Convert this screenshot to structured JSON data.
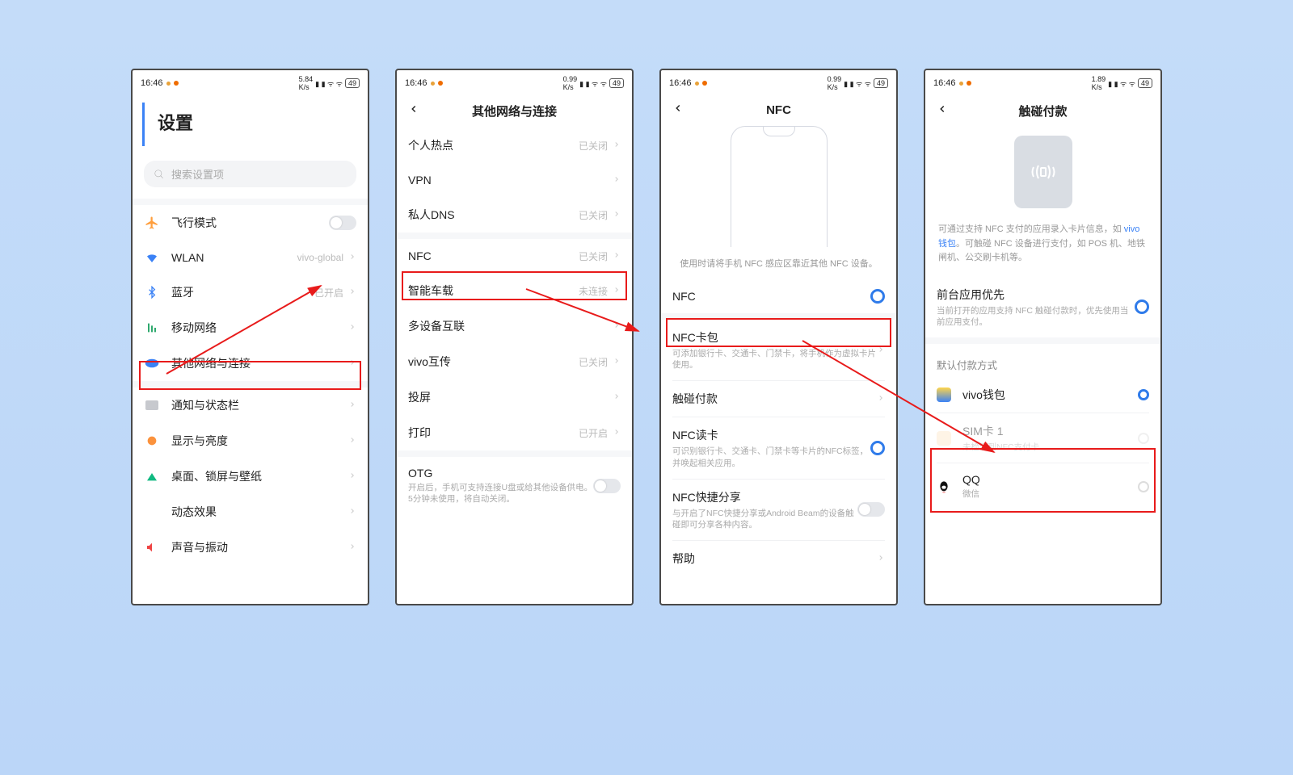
{
  "status": {
    "time": "16:46",
    "right_text": "49"
  },
  "p1": {
    "title": "设置",
    "search_placeholder": "搜索设置项",
    "rows": {
      "airplane": "飞行模式",
      "wlan": "WLAN",
      "wlan_val": "vivo-global",
      "bt": "蓝牙",
      "bt_val": "已开启",
      "mobile": "移动网络",
      "other": "其他网络与连接",
      "notif": "通知与状态栏",
      "display": "显示与亮度",
      "home": "桌面、锁屏与壁纸",
      "motion": "动态效果",
      "sound": "声音与振动"
    }
  },
  "p2": {
    "title": "其他网络与连接",
    "rows": {
      "hotspot": "个人热点",
      "hotspot_val": "已关闭",
      "vpn": "VPN",
      "dns": "私人DNS",
      "dns_val": "已关闭",
      "nfc": "NFC",
      "nfc_val": "已关闭",
      "car": "智能车载",
      "car_val": "未连接",
      "multi": "多设备互联",
      "vshare": "vivo互传",
      "vshare_val": "已关闭",
      "cast": "投屏",
      "print": "打印",
      "print_val": "已开启",
      "otg": "OTG",
      "otg_desc": "开启后，手机可支持连接U盘或给其他设备供电。5分钟未使用，将自动关闭。"
    }
  },
  "p3": {
    "title": "NFC",
    "hint": "使用时请将手机 NFC 感应区靠近其他 NFC 设备。",
    "rows": {
      "nfc": "NFC",
      "cardpkg": "NFC卡包",
      "cardpkg_desc": "可添加银行卡、交通卡、门禁卡，将手机作为虚拟卡片使用。",
      "tap": "触碰付款",
      "reader": "NFC读卡",
      "reader_desc": "可识别银行卡、交通卡、门禁卡等卡片的NFC标签，并唤起相关应用。",
      "share": "NFC快捷分享",
      "share_desc": "与开启了NFC快捷分享或Android Beam的设备触碰即可分享各种内容。",
      "help": "帮助"
    }
  },
  "p4": {
    "title": "触碰付款",
    "hint_html_before": "可通过支持 NFC 支付的应用录入卡片信息，如 ",
    "hint_link": "vivo钱包",
    "hint_html_after": "。可触碰 NFC 设备进行支付，如 POS 机、地铁闸机、公交刷卡机等。",
    "fg": "前台应用优先",
    "fg_desc": "当前打开的应用支持 NFC 触碰付款时，优先使用当前应用支付。",
    "section": "默认付款方式",
    "opts": {
      "vivo": "vivo钱包",
      "sim": "SIM卡 1",
      "sim_desc": "未检测到NFC支付卡",
      "qq": "QQ",
      "qq_desc": "微信"
    }
  }
}
